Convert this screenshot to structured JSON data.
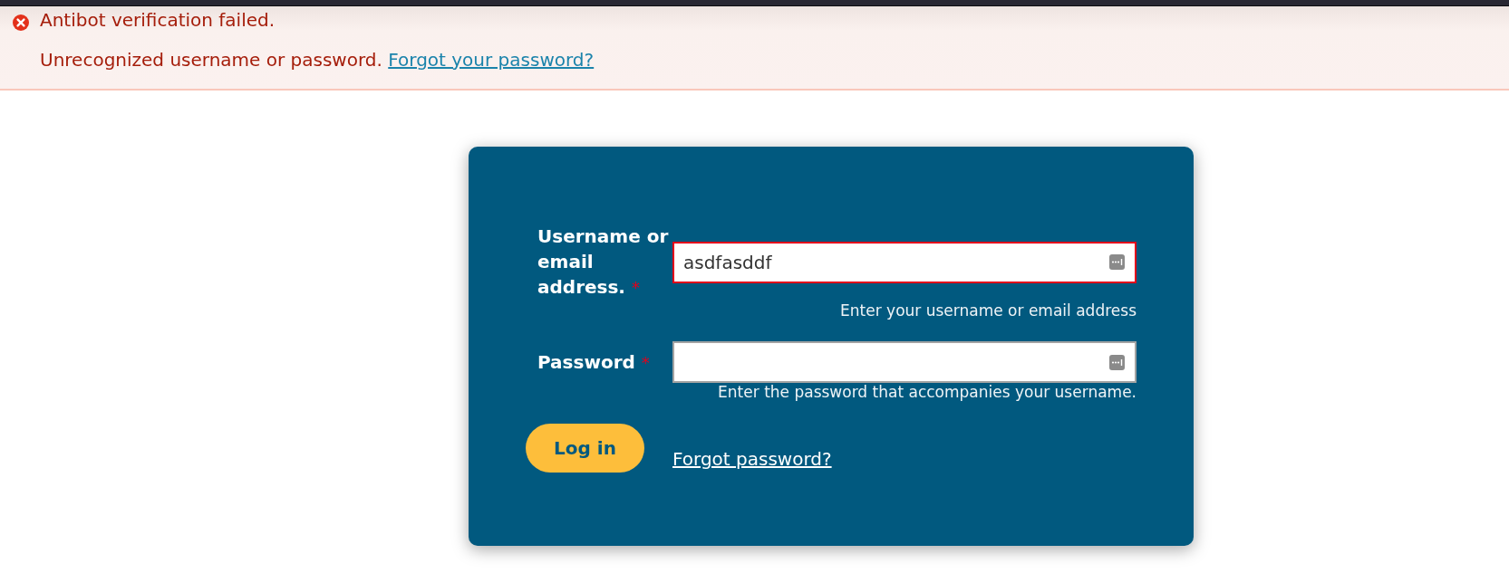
{
  "status_messages": {
    "items": [
      {
        "text": "Antibot verification failed."
      },
      {
        "text": "Unrecognized username or password.",
        "link": "Forgot your password?"
      }
    ]
  },
  "login_form": {
    "fields": [
      {
        "label": "Username or email address.",
        "required_mark": "*",
        "value": "asdfasddf",
        "invalid": true,
        "description": "Enter your username or email address"
      },
      {
        "label": "Password",
        "required_mark": "*",
        "invalid": false,
        "description": "Enter the password that accompanies your username."
      }
    ],
    "submit_button": "Log in",
    "forgot_link": "Forgot password?"
  }
}
